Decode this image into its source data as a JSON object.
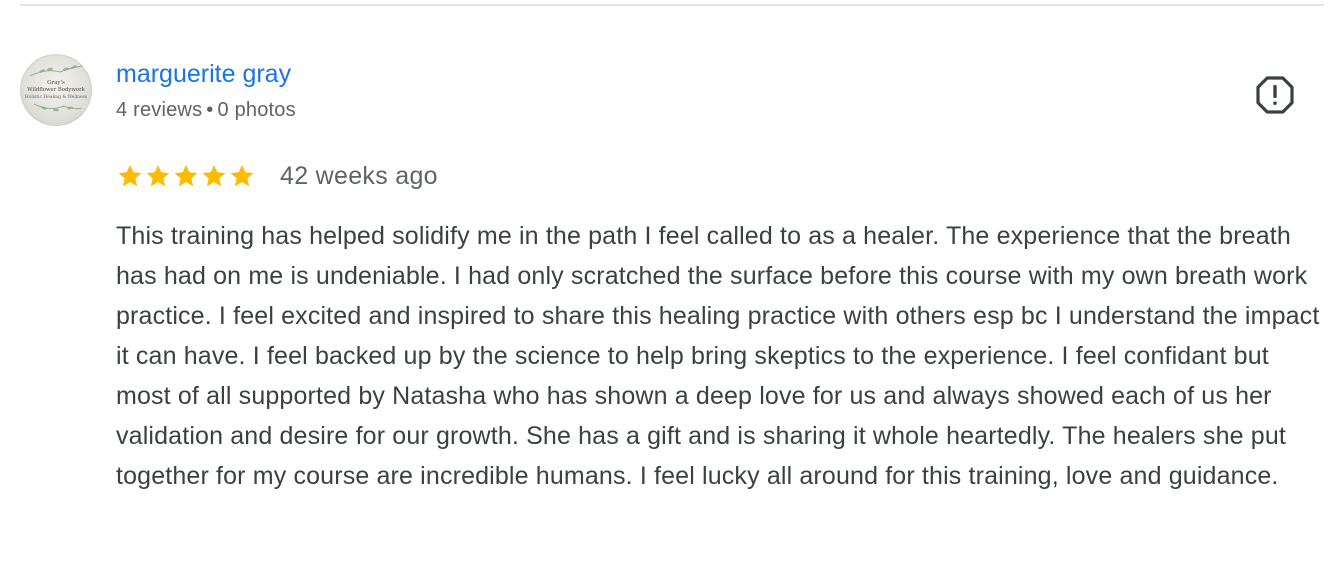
{
  "review": {
    "author": "marguerite gray",
    "avatar_logo_text": [
      "Gray's",
      "Wildflower Bodywork",
      "Holistic Healing & Wellness"
    ],
    "reviews_count": "4 reviews",
    "separator": "•",
    "photos_count": "0 photos",
    "rating": 5,
    "rating_max": 5,
    "star_color": "#fbbc04",
    "date": "42 weeks ago",
    "text": "This training has helped solidify me in the path I feel called to as a healer. The experience that the breath has had on me is undeniable. I had only scratched the surface before this course with my own breath work practice. I feel excited and inspired to share this healing practice with others esp bc I understand the impact it can have. I feel backed up by the science to help bring skeptics to the experience. I feel confidant but most of all supported by Natasha who has shown a deep love for us and always showed each of us her validation and desire for our growth. She has a gift and is sharing it whole heartedly. The healers she put together for my course are incredible humans. I feel lucky all around for this training, love and guidance.",
    "report_icon": "report-flag-icon",
    "author_color": "#1a73e8"
  }
}
